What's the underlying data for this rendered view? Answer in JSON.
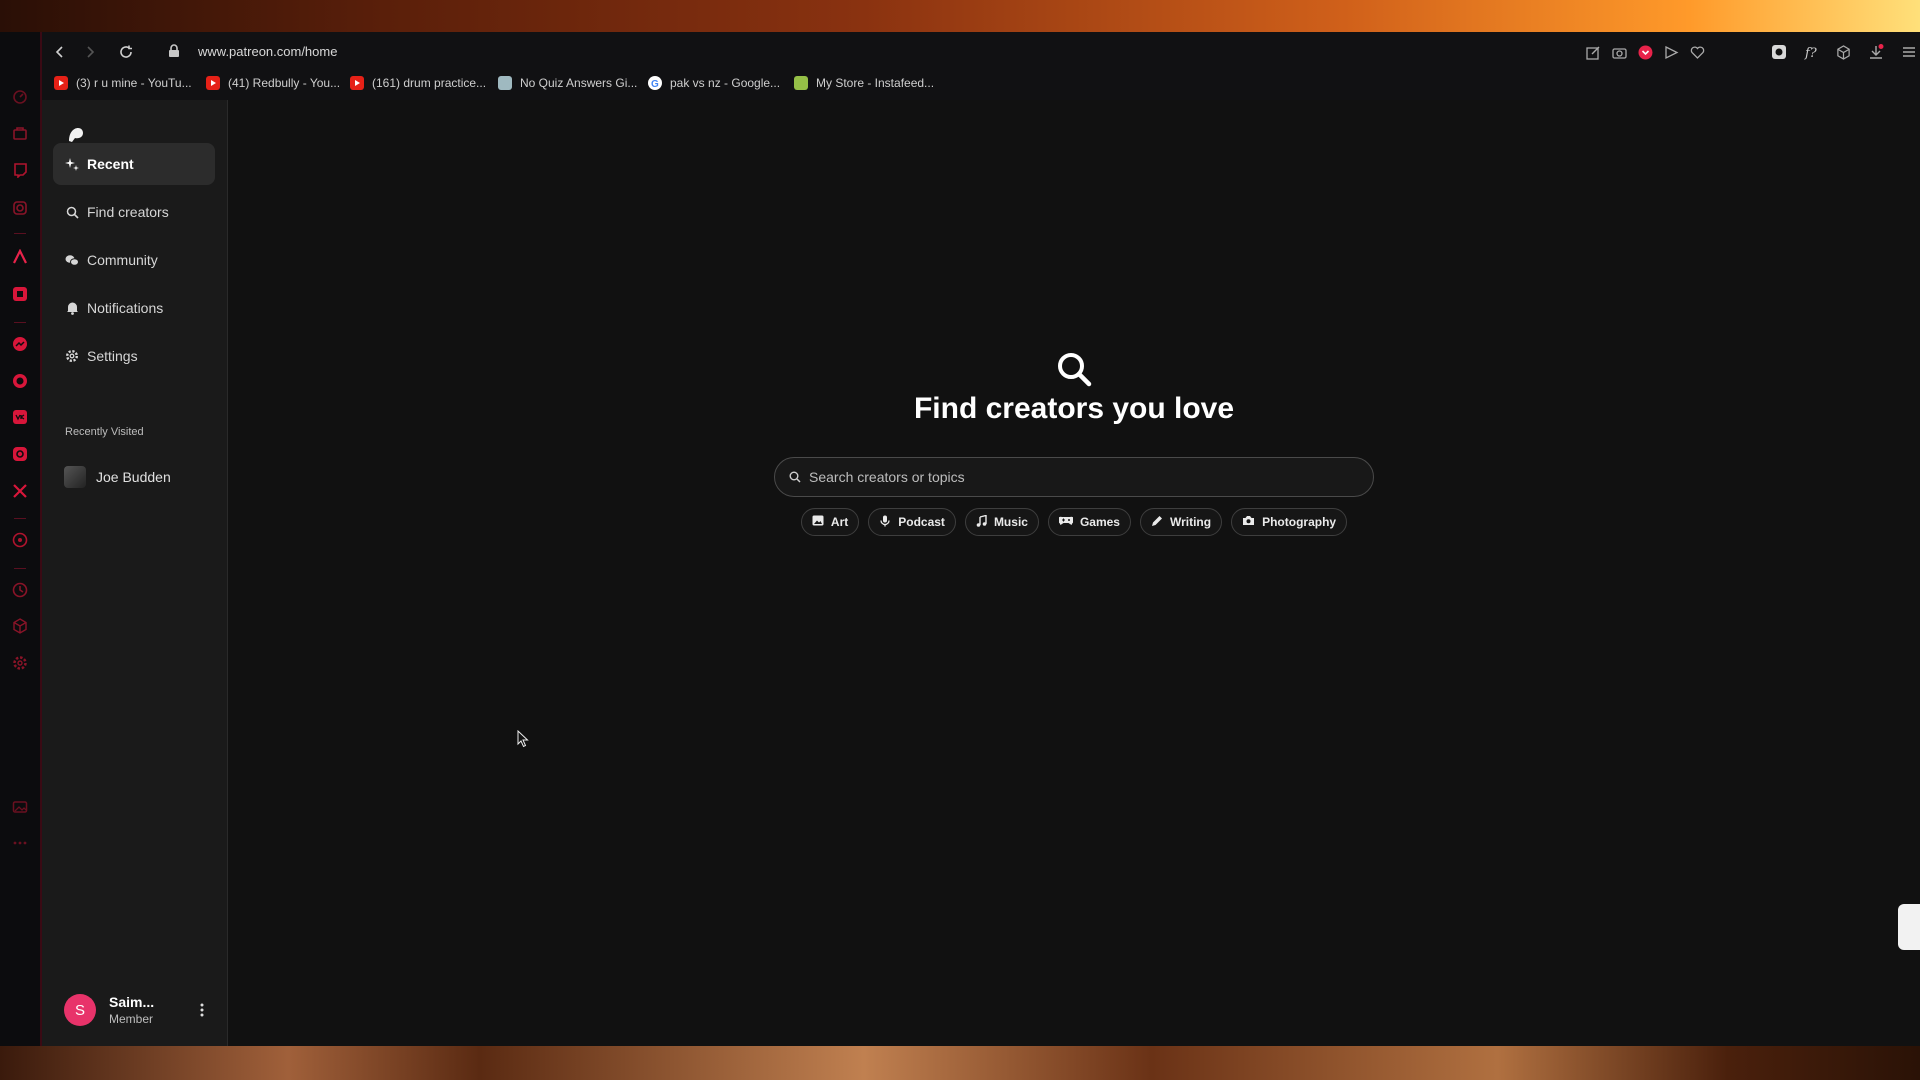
{
  "browser": {
    "url": "www.patreon.com/home",
    "bookmarks": [
      {
        "label": "(3) r u mine - YouTu...",
        "icon": "youtube-icon"
      },
      {
        "label": "(41) Redbully - You...",
        "icon": "youtube-icon"
      },
      {
        "label": "(161) drum practice...",
        "icon": "youtube-icon"
      },
      {
        "label": "No Quiz Answers Gi...",
        "icon": "page-icon"
      },
      {
        "label": "pak vs nz - Google...",
        "icon": "google-icon"
      },
      {
        "label": "My Store - Instafeed...",
        "icon": "shopify-icon"
      }
    ],
    "rail_icons": [
      "speed-dial-icon",
      "bag-icon",
      "twitch-icon",
      "instagram-icon",
      "aria-icon",
      "youtube-music-icon",
      "messenger-icon",
      "whatsapp-icon",
      "vk-icon",
      "instagram-icon",
      "x-icon",
      "player-icon",
      "history-icon",
      "cube-icon",
      "settings-icon",
      "gallery-icon",
      "more-icon"
    ],
    "accent": "#e8234a"
  },
  "sidebar": {
    "items": [
      {
        "label": "Recent",
        "icon": "sparkle-icon"
      },
      {
        "label": "Find creators",
        "icon": "search-icon"
      },
      {
        "label": "Community",
        "icon": "chat-icon"
      },
      {
        "label": "Notifications",
        "icon": "bell-icon"
      },
      {
        "label": "Settings",
        "icon": "gear-icon"
      }
    ],
    "recently_visited_heading": "Recently Visited",
    "recently_visited": [
      {
        "label": "Joe Budden"
      }
    ],
    "user": {
      "initial": "S",
      "name": "Saim...",
      "role": "Member"
    }
  },
  "main": {
    "title": "Find creators you love",
    "search_placeholder": "Search creators or topics",
    "chips": [
      {
        "label": "Art",
        "icon": "image-icon"
      },
      {
        "label": "Podcast",
        "icon": "microphone-icon"
      },
      {
        "label": "Music",
        "icon": "music-note-icon"
      },
      {
        "label": "Games",
        "icon": "gamepad-icon"
      },
      {
        "label": "Writing",
        "icon": "pencil-icon"
      },
      {
        "label": "Photography",
        "icon": "camera-icon"
      }
    ]
  }
}
